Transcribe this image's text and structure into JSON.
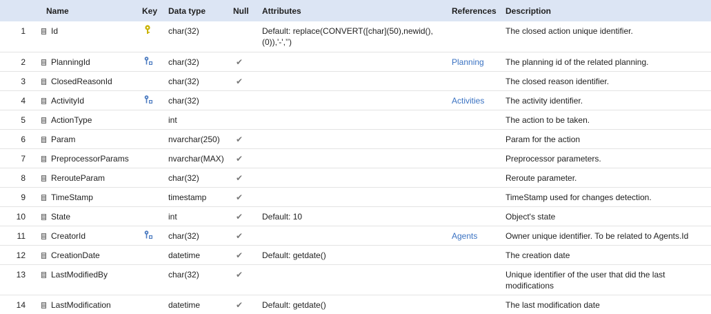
{
  "colors": {
    "header_bg": "#dce5f4",
    "link": "#3a72c2",
    "pk_icon": "#c9b200",
    "fk_icon": "#4a7ac0"
  },
  "header": {
    "name": "Name",
    "key": "Key",
    "data_type": "Data type",
    "null": "Null",
    "attributes": "Attributes",
    "references": "References",
    "description": "Description"
  },
  "rows": [
    {
      "num": "1",
      "name": "Id",
      "key": "primary-key-icon",
      "type": "char(32)",
      "null": false,
      "attributes": "Default: replace(CONVERT([char](50),newid(),(0)),'-',’’)",
      "references": "",
      "description": "The closed action unique identifier."
    },
    {
      "num": "2",
      "name": "PlanningId",
      "key": "foreign-key-icon",
      "type": "char(32)",
      "null": true,
      "attributes": "",
      "references": "Planning",
      "description": "The planning id of the related planning."
    },
    {
      "num": "3",
      "name": "ClosedReasonId",
      "key": "",
      "type": "char(32)",
      "null": true,
      "attributes": "",
      "references": "",
      "description": "The closed reason identifier."
    },
    {
      "num": "4",
      "name": "ActivityId",
      "key": "foreign-key-icon",
      "type": "char(32)",
      "null": false,
      "attributes": "",
      "references": "Activities",
      "description": "The activity identifier."
    },
    {
      "num": "5",
      "name": "ActionType",
      "key": "",
      "type": "int",
      "null": false,
      "attributes": "",
      "references": "",
      "description": "The action to be taken."
    },
    {
      "num": "6",
      "name": "Param",
      "key": "",
      "type": "nvarchar(250)",
      "null": true,
      "attributes": "",
      "references": "",
      "description": "Param for the action"
    },
    {
      "num": "7",
      "name": "PreprocessorParams",
      "key": "",
      "type": "nvarchar(MAX)",
      "null": true,
      "attributes": "",
      "references": "",
      "description": "Preprocessor parameters."
    },
    {
      "num": "8",
      "name": "RerouteParam",
      "key": "",
      "type": "char(32)",
      "null": true,
      "attributes": "",
      "references": "",
      "description": "Reroute parameter."
    },
    {
      "num": "9",
      "name": "TimeStamp",
      "key": "",
      "type": "timestamp",
      "null": true,
      "attributes": "",
      "references": "",
      "description": "TimeStamp used for changes detection."
    },
    {
      "num": "10",
      "name": "State",
      "key": "",
      "type": "int",
      "null": true,
      "attributes": "Default: 10",
      "references": "",
      "description": "Object's state"
    },
    {
      "num": "11",
      "name": "CreatorId",
      "key": "foreign-key-icon",
      "type": "char(32)",
      "null": true,
      "attributes": "",
      "references": "Agents",
      "description": "Owner unique identifier. To be related to Agents.Id"
    },
    {
      "num": "12",
      "name": "CreationDate",
      "key": "",
      "type": "datetime",
      "null": true,
      "attributes": "Default: getdate()",
      "references": "",
      "description": "The creation date"
    },
    {
      "num": "13",
      "name": "LastModifiedBy",
      "key": "",
      "type": "char(32)",
      "null": true,
      "attributes": "",
      "references": "",
      "description": "Unique identifier of the user that did the last modifications"
    },
    {
      "num": "14",
      "name": "LastModification",
      "key": "",
      "type": "datetime",
      "null": true,
      "attributes": "Default: getdate()",
      "references": "",
      "description": "The last modification date"
    }
  ],
  "null_mark": "✔"
}
